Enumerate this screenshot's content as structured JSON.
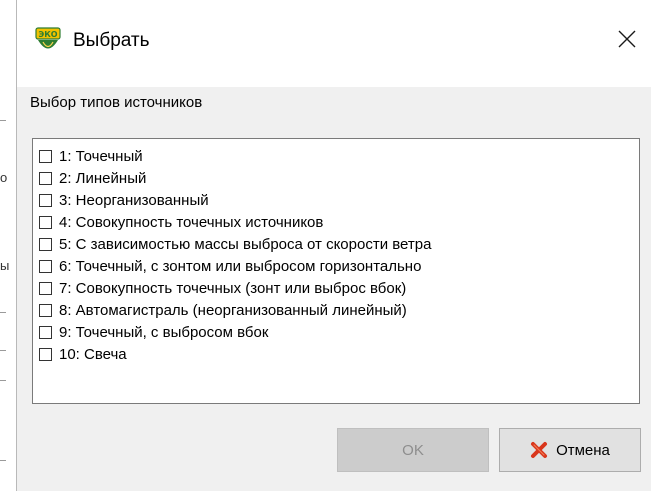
{
  "dialog": {
    "title": "Выбрать",
    "app_icon": "eco-app-icon",
    "close_icon": "close-icon",
    "group_label": "Выбор типов источников",
    "items": [
      {
        "label": "1: Точечный",
        "checked": false
      },
      {
        "label": "2: Линейный",
        "checked": false
      },
      {
        "label": "3: Неорганизованный",
        "checked": false
      },
      {
        "label": "4: Совокупность точечных источников",
        "checked": false
      },
      {
        "label": "5: С зависимостью массы выброса от скорости ветра",
        "checked": false
      },
      {
        "label": "6: Точечный, с зонтом или выбросом горизонтально",
        "checked": false
      },
      {
        "label": "7: Совокупность точечных (зонт или выброс вбок)",
        "checked": false
      },
      {
        "label": "8: Автомагистраль (неорганизованный линейный)",
        "checked": false
      },
      {
        "label": "9: Точечный, с выбросом вбок",
        "checked": false
      },
      {
        "label": "10: Свеча",
        "checked": false
      }
    ],
    "ok_label": "OK",
    "ok_enabled": false,
    "cancel_label": "Отмена",
    "cancel_icon": "red-cross-icon"
  },
  "background": {
    "edge_chars": [
      "о",
      "ы"
    ]
  },
  "colors": {
    "dialog_bg": "#f0f0f0",
    "titlebar_bg": "#ffffff",
    "disabled_button": "#cccccc",
    "cancel_icon_red": "#d9361c"
  }
}
